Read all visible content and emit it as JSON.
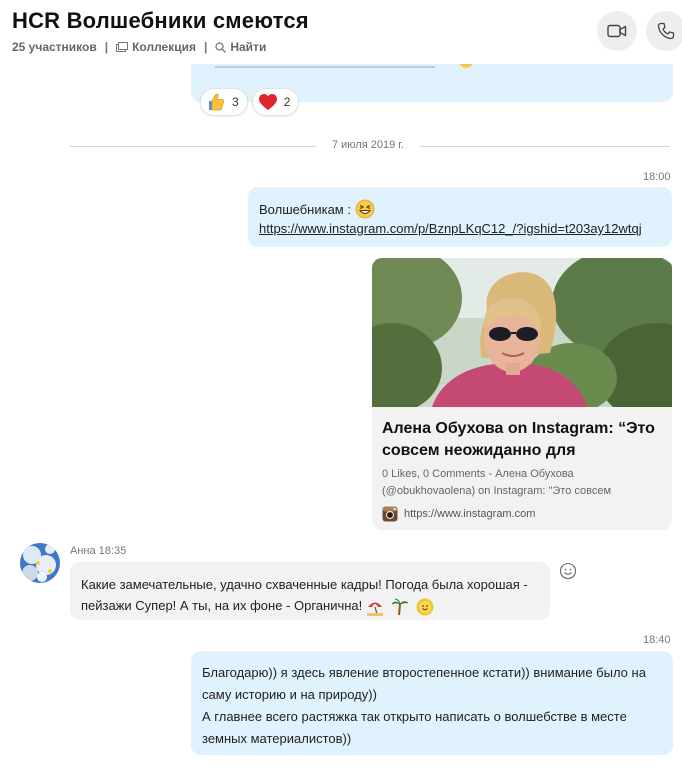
{
  "header": {
    "title": "HCR Волшебники смеются",
    "participants": "25 участников",
    "gallery": "Коллекция",
    "find": "Найти"
  },
  "reactions": [
    {
      "icon": "thumbs-up-icon",
      "count": "3"
    },
    {
      "icon": "heart-icon",
      "count": "2"
    }
  ],
  "date_divider": "7 июля 2019 г.",
  "messages": {
    "out1": {
      "time": "18:00",
      "line1": "Волшебникам :",
      "link": "https://www.instagram.com/p/BznpLKqC12_/?igshid=t203ay12wtqj"
    },
    "card": {
      "title": "Алена Обухова on Instagram: “Это совсем неожиданно для",
      "description": "0 Likes, 0 Comments - Алена Обухова (@obukhovaolena) on Instagram: \"Это совсем",
      "source": "https://www.instagram.com"
    },
    "in1": {
      "sender": "Анна 18:35",
      "text": "Какие замечательные, удачно схваченные кадры! Погода была хорошая - пейзажи Супер! А ты, на их фоне - Органична!"
    },
    "out2": {
      "time": "18:40",
      "line1": "Благодарю)) я здесь явление второстепенное кстати)) внимание было на саму историю и на природу))",
      "line2": "А главнее всего растяжка так открыто написать о волшебстве в месте земных материалистов))"
    }
  },
  "colors": {
    "outgoing_bubble": "#dff2fd",
    "incoming_bubble": "#f2f2f2",
    "heart": "#e0242c"
  }
}
